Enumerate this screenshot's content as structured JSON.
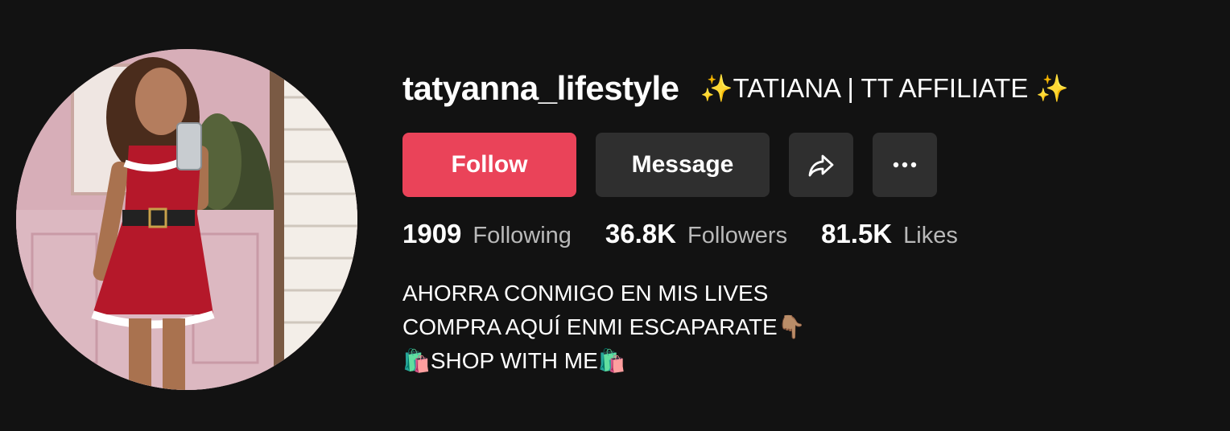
{
  "profile": {
    "username": "tatyanna_lifestyle",
    "nickname": "✨TATIANA | TT AFFILIATE ✨",
    "avatar_icon": "profile-photo"
  },
  "actions": {
    "follow_label": "Follow",
    "message_label": "Message",
    "share_icon": "share-arrow-icon",
    "more_icon": "more-dots-icon"
  },
  "stats": {
    "following_count": "1909",
    "following_label": "Following",
    "followers_count": "36.8K",
    "followers_label": "Followers",
    "likes_count": "81.5K",
    "likes_label": "Likes"
  },
  "bio": {
    "line1": "AHORRA CONMIGO EN MIS LIVES",
    "line2": "COMPRA AQUÍ ENMI ESCAPARATE👇🏽",
    "line3": "🛍️SHOP WITH ME🛍️"
  },
  "colors": {
    "background": "#121212",
    "follow_button": "#ea4359",
    "secondary_button": "#2f2f2f",
    "muted_text": "#b9b9b9"
  }
}
